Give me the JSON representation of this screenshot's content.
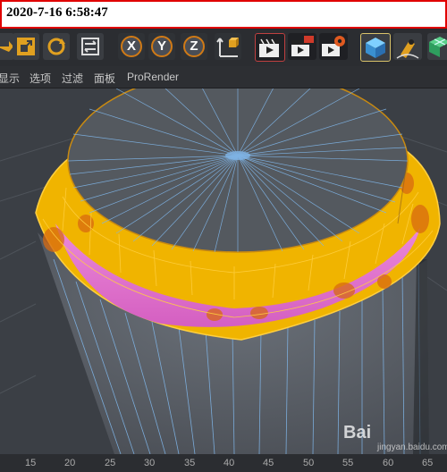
{
  "stamp": {
    "datetime": "2020-7-16 6:58:47"
  },
  "toolbar": {
    "axis_x": "X",
    "axis_y": "Y",
    "axis_z": "Z"
  },
  "menu": [
    "显示",
    "选项",
    "过滤",
    "面板",
    "ProRender"
  ],
  "ruler": [
    "15",
    "20",
    "25",
    "30",
    "35",
    "40",
    "45",
    "50",
    "55",
    "60",
    "65"
  ],
  "watermark": {
    "brand": "Bai",
    "sub": "jingyan.baidu.com"
  },
  "colors": {
    "selection_pink": "#e271d0",
    "selection_orange": "#f0b400",
    "wire_blue": "#7fb4e6",
    "viewport_bg": "#3b3f45",
    "stamp_border": "#e00000"
  },
  "icons": [
    "move-icon",
    "scale-icon",
    "rotate-icon",
    "transform-icon",
    "axis-x-icon",
    "axis-y-icon",
    "axis-z-icon",
    "coordinate-icon",
    "render-view-icon",
    "render-pv-icon",
    "render-settings-icon",
    "cube-icon",
    "pen-icon",
    "subdivide-icon"
  ]
}
